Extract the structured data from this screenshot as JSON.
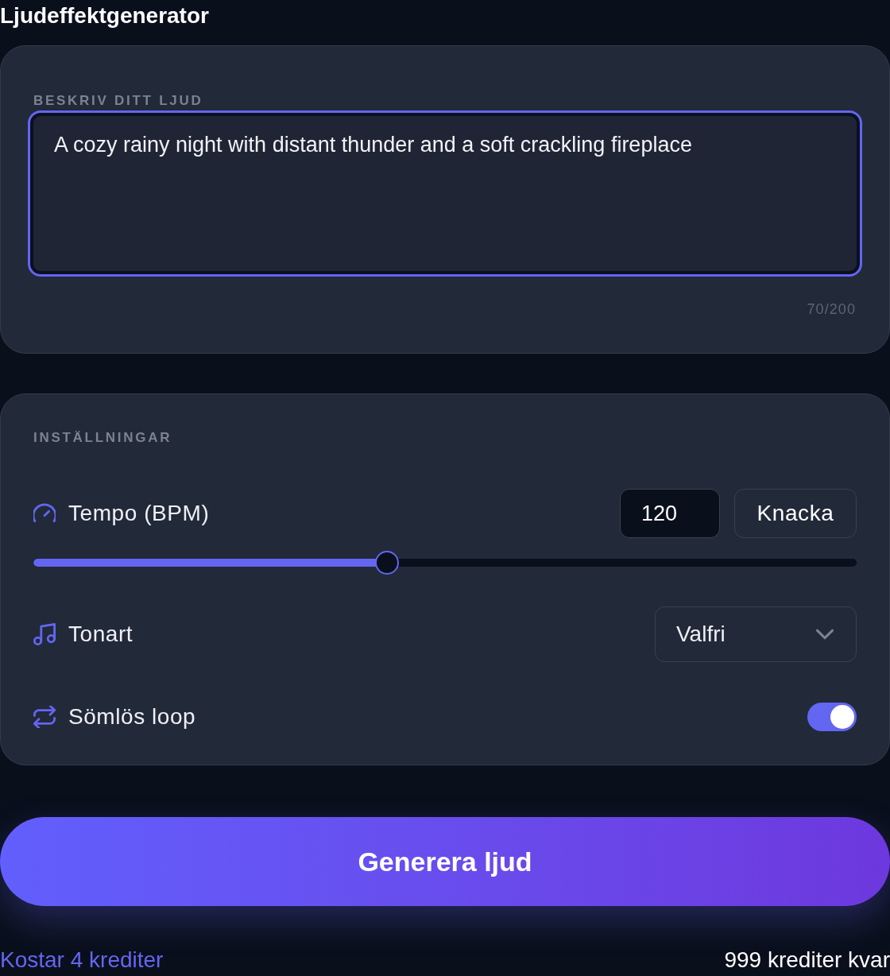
{
  "title": "Ljudeffektgenerator",
  "prompt": {
    "label": "BESKRIV DITT LJUD",
    "value": "A cozy rainy night with distant thunder and a soft crackling fireplace",
    "focused": true,
    "counter": "70/200"
  },
  "settings": {
    "heading": "INSTÄLLNINGAR",
    "rows": [
      {
        "kind": "tempo",
        "label": "Tempo (BPM)",
        "value": "120",
        "button": "Knacka",
        "level": 0.43
      },
      {
        "kind": "select",
        "label": "Tonart",
        "value": "Valfri"
      },
      {
        "kind": "toggle",
        "label": "Sömlös loop",
        "on": true
      }
    ]
  },
  "generate_button": "Generera ljud",
  "footer": {
    "cost": "Kostar 4 krediter",
    "balance": "999 krediter kvar"
  }
}
